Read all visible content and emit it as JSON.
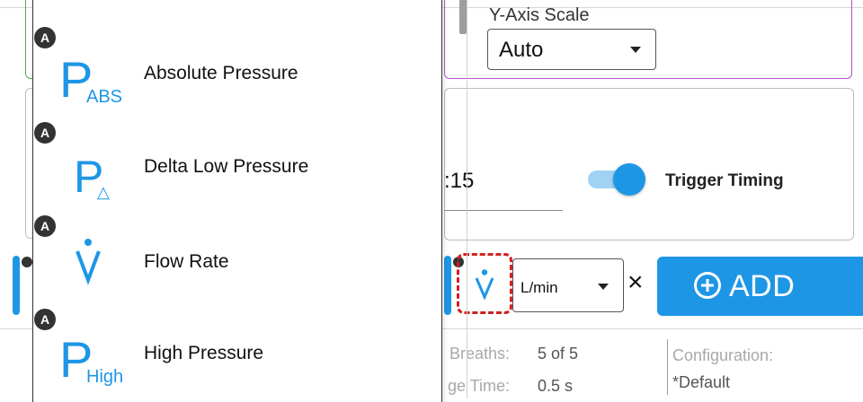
{
  "chart_settings": {
    "y_axis_scale_label": "Y-Axis Scale",
    "y_axis_scale_value": "Auto"
  },
  "timing": {
    "time_value": ":15",
    "trigger_toggle_on": true,
    "trigger_label": "Trigger Timing"
  },
  "measurement_row": {
    "unit_value": "L/min",
    "remove_label": "×",
    "add_label": "ADD"
  },
  "footer": {
    "breaths_label": "Breaths:",
    "breaths_value": "5 of 5",
    "time_label": "ge Time:",
    "time_value": "0.5 s",
    "config_label": "Configuration:",
    "config_value": "*Default"
  },
  "menu": {
    "items": [
      {
        "badge": "A",
        "symbol": "P",
        "subscript": "ABS",
        "label": "Absolute Pressure"
      },
      {
        "badge": "A",
        "symbol": "P",
        "subscript": "△",
        "label": "Delta Low Pressure"
      },
      {
        "badge": "A",
        "symbol": "V",
        "subscript": "",
        "label": "Flow Rate"
      },
      {
        "badge": "A",
        "symbol": "P",
        "subscript": "High",
        "label": "High Pressure"
      }
    ]
  },
  "colors": {
    "accent_blue": "#1e96e6",
    "highlight_red": "#d32020",
    "panel_purple": "#b650c8",
    "panel_green": "#4caf50"
  }
}
